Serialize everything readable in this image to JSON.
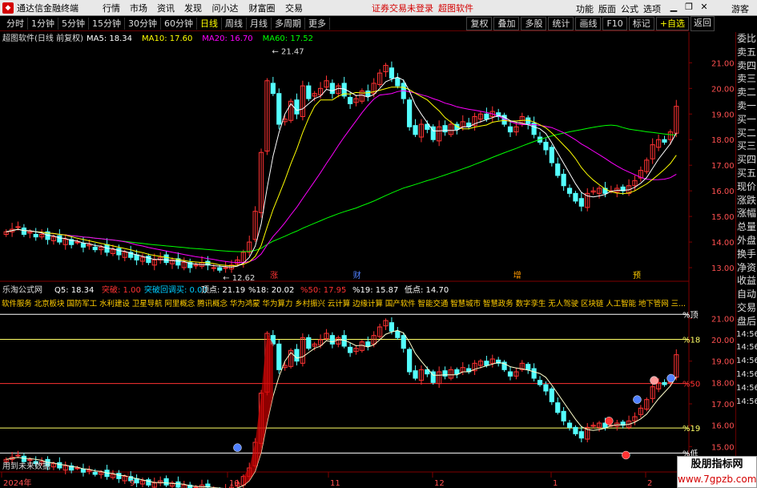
{
  "menubar": {
    "app_title": "通达信金融终端",
    "items": [
      "行情",
      "市场",
      "资讯",
      "发现",
      "问小达",
      "财富圈",
      "交易"
    ],
    "login_status": "证券交易未登录",
    "login_brand": "超图软件",
    "right_items": [
      "功能",
      "版面",
      "公式",
      "选项"
    ],
    "guest": "游客"
  },
  "periodbar": {
    "tabs": [
      "分时",
      "1分钟",
      "5分钟",
      "15分钟",
      "30分钟",
      "60分钟",
      "日线",
      "周线",
      "月线",
      "多周期",
      "更多"
    ],
    "active": "日线",
    "tools": [
      "复权",
      "叠加",
      "多股",
      "统计",
      "画线",
      "F10",
      "标记",
      "+自选",
      "返回"
    ]
  },
  "main_chart": {
    "title": "超图软件(日线 前复权)",
    "ma_legend": [
      {
        "label": "MA5: 18.34",
        "color": "#ffffff"
      },
      {
        "label": "MA10: 17.60",
        "color": "#ffff00"
      },
      {
        "label": "MA20: 16.70",
        "color": "#ff00ff"
      },
      {
        "label": "MA60: 17.52",
        "color": "#00ff00"
      }
    ],
    "price_axis": [
      "21.00",
      "20.00",
      "19.00",
      "18.00",
      "17.00",
      "16.00",
      "15.00",
      "14.00",
      "13.00"
    ],
    "high_label": "21.47",
    "low_label": "12.62",
    "markers": [
      "涨",
      "财",
      "增",
      "预"
    ]
  },
  "sub_chart": {
    "title": "乐淘公式网",
    "legend": [
      {
        "label": "Q5: 18.34",
        "color": "#ffffff"
      },
      {
        "label": "突破: 1.00",
        "color": "#ff3333"
      },
      {
        "label": "突破回调买: 0.00",
        "color": "#00ccff"
      },
      {
        "label": "顶点: 21.19",
        "color": "#ffffff"
      },
      {
        "label": "%18: 20.02",
        "color": "#ffffff"
      },
      {
        "label": "%50: 17.95",
        "color": "#ff3333"
      },
      {
        "label": "%19: 15.87",
        "color": "#ffffff"
      },
      {
        "label": "低点: 14.70",
        "color": "#ffffff"
      }
    ],
    "concepts": "软件服务 北京板块 国防军工 水利建设 卫星导航 阿里概念 腾讯概念 华为鸿蒙 华为算力 乡村振兴 云计算 边缘计算 国产软件 智能交通 智慧城市 智慧政务 数字孪生 无人驾驶 区块链 人工智能 地下管网 三...",
    "price_axis": [
      "21.00",
      "20.00",
      "19.00",
      "18.00",
      "17.00",
      "16.00",
      "15.00"
    ],
    "level_labels": [
      "%顶",
      "%18",
      "%50",
      "%19",
      "%低"
    ],
    "footer_text": "用到未来数据"
  },
  "date_axis": [
    "2024年",
    "9",
    "10",
    "11",
    "12",
    "1",
    "2"
  ],
  "side_panel": {
    "top_buttons": [
      "返回"
    ],
    "items": [
      "委比",
      "卖五",
      "卖四",
      "卖三",
      "卖二",
      "卖一",
      "买一",
      "买二",
      "买三",
      "买四",
      "买五",
      "现价",
      "涨跌",
      "涨幅",
      "总量",
      "外盘",
      "换手",
      "净资",
      "收益",
      "",
      "自动",
      "交易",
      "盘后",
      "14:56",
      "14:56",
      "14:56",
      "14:56",
      "14:56",
      "14:56"
    ]
  },
  "watermark": {
    "line1": "股朋指标网",
    "line2": "www.7gpzb.com"
  },
  "colors": {
    "up": "#ff3333",
    "down": "#54ffff",
    "ma5": "#ffffff",
    "ma10": "#ffff00",
    "ma20": "#ff00ff",
    "ma60": "#00ff00"
  }
}
